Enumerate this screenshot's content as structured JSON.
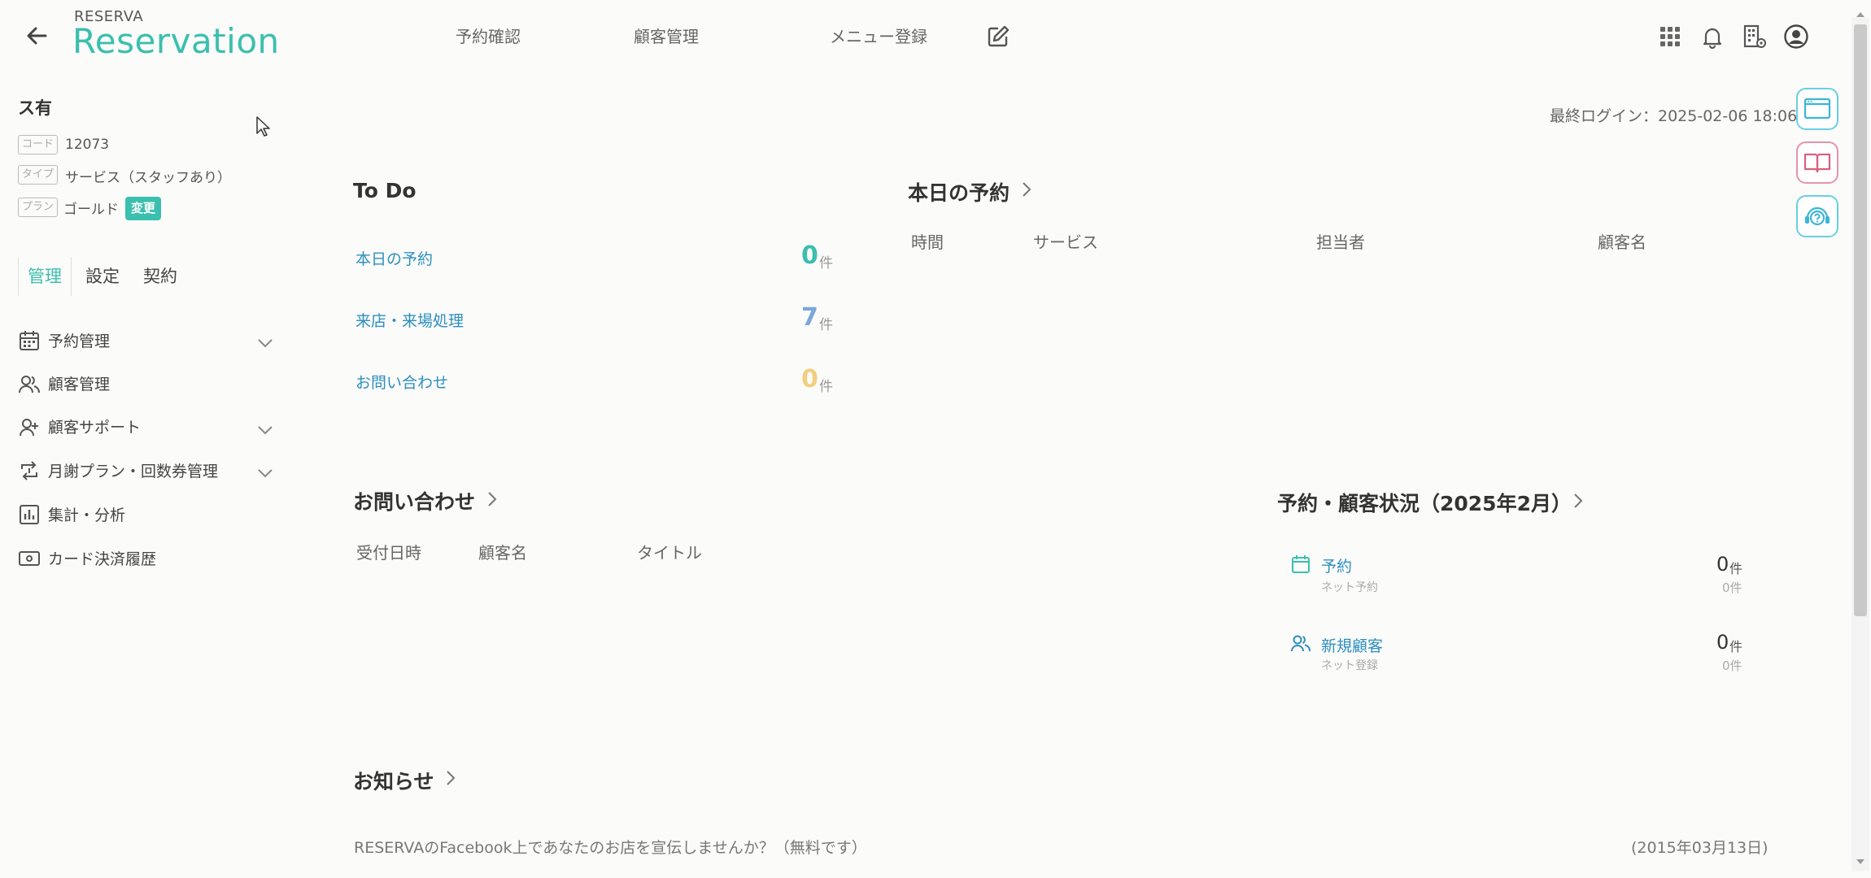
{
  "header": {
    "logo_small": "RESERVA",
    "logo_big": "Reservation",
    "nav": [
      "予約確認",
      "顧客管理",
      "メニュー登録"
    ]
  },
  "sidebar": {
    "store_name": "ス有",
    "code_label": "コード",
    "code_value": "12073",
    "type_label": "タイプ",
    "type_value": "サービス（スタッフあり）",
    "plan_label": "プラン",
    "plan_value": "ゴールド",
    "plan_change": "変更",
    "tabs": [
      "管理",
      "設定",
      "契約"
    ],
    "menu": [
      {
        "label": "予約管理",
        "icon": "calendar-icon",
        "expandable": true
      },
      {
        "label": "顧客管理",
        "icon": "users-icon",
        "expandable": false
      },
      {
        "label": "顧客サポート",
        "icon": "user-plus-icon",
        "expandable": true
      },
      {
        "label": "月謝プラン・回数券管理",
        "icon": "repeat-icon",
        "expandable": true
      },
      {
        "label": "集計・分析",
        "icon": "bar-chart-icon",
        "expandable": false
      },
      {
        "label": "カード決済履歴",
        "icon": "card-icon",
        "expandable": false
      }
    ]
  },
  "last_login": "最終ログイン：2025-02-06 18:06",
  "todo": {
    "title": "To Do",
    "unit": "件",
    "items": [
      {
        "label": "本日の予約",
        "count": "0",
        "color": "#3bbfae"
      },
      {
        "label": "来店・来場処理",
        "count": "7",
        "color": "#7aa6dc"
      },
      {
        "label": "お問い合わせ",
        "count": "0",
        "color": "#f2cf7e"
      }
    ]
  },
  "today_reservations": {
    "title": "本日の予約",
    "columns": [
      "時間",
      "サービス",
      "担当者",
      "顧客名"
    ]
  },
  "inquiries": {
    "title": "お問い合わせ",
    "columns": [
      "受付日時",
      "顧客名",
      "タイトル"
    ]
  },
  "status": {
    "title": "予約・顧客状況（2025年2月）",
    "items": [
      {
        "label": "予約",
        "sub": "ネット予約",
        "count": "0",
        "unit": "件",
        "sub_count": "0件"
      },
      {
        "label": "新規顧客",
        "sub": "ネット登録",
        "count": "0",
        "unit": "件",
        "sub_count": "0件"
      }
    ]
  },
  "news": {
    "title": "お知らせ",
    "items": [
      {
        "text": "RESERVAのFacebook上であなたのお店を宣伝しませんか？（無料です）",
        "date": "(2015年03月13日)"
      }
    ]
  },
  "colors": {
    "accent": "#3bbfae",
    "link": "#2c8fbf"
  }
}
